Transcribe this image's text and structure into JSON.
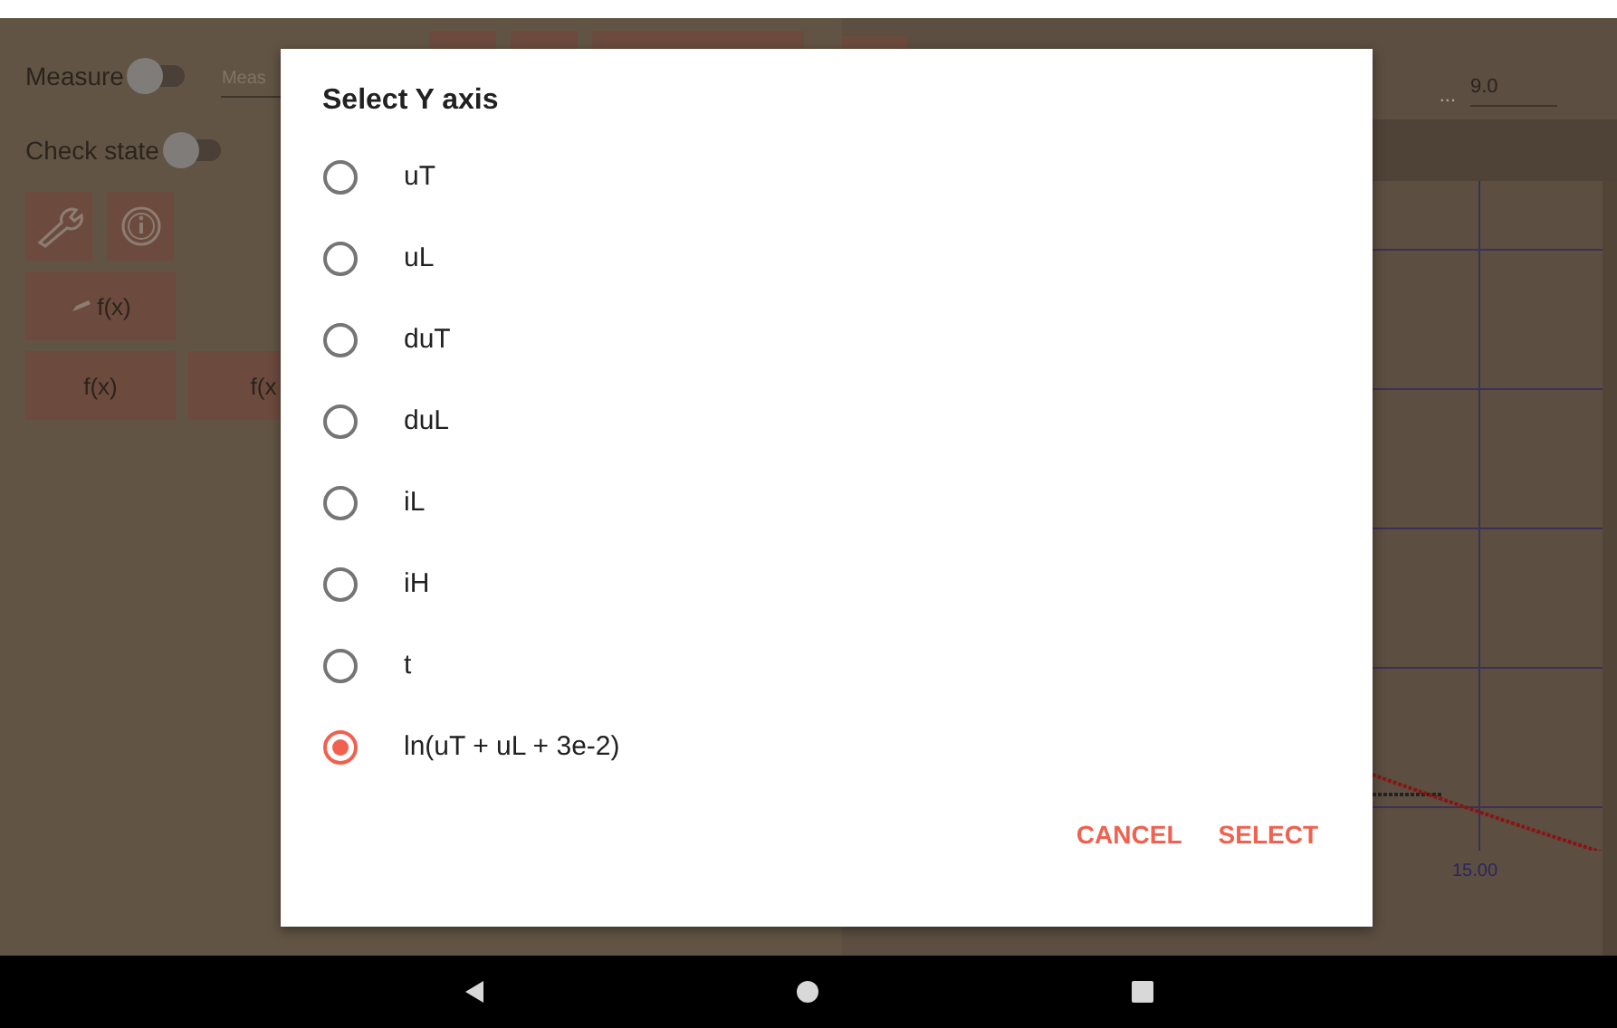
{
  "background": {
    "measure_toggle": {
      "label": "Measure",
      "on": false
    },
    "measure_field": {
      "placeholder": "Meas"
    },
    "check_state_toggle": {
      "label": "Check state",
      "on": false
    },
    "edit_function_button": "f(x)",
    "function_buttons": [
      "f(x)",
      "f(x"
    ],
    "range_separator": "...",
    "range_end_field": {
      "value": "9.0"
    },
    "x_axis_tick": "15.00"
  },
  "dialog": {
    "title": "Select Y axis",
    "options": [
      {
        "label": "uT",
        "selected": false
      },
      {
        "label": "uL",
        "selected": false
      },
      {
        "label": "duT",
        "selected": false
      },
      {
        "label": "duL",
        "selected": false
      },
      {
        "label": "iL",
        "selected": false
      },
      {
        "label": "iH",
        "selected": false
      },
      {
        "label": "t",
        "selected": false
      },
      {
        "label": "ln(uT + uL + 3e-2)",
        "selected": true
      }
    ],
    "buttons": [
      "CANCEL",
      "SELECT"
    ]
  }
}
